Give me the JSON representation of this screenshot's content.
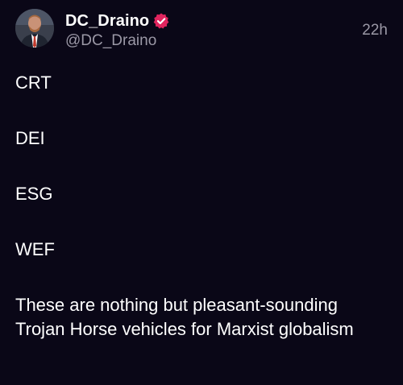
{
  "author": {
    "display_name": "DC_Draino",
    "handle": "@DC_Draino",
    "avatar_icon": "profile-photo",
    "verified_icon": "verified-badge-icon",
    "verified_color": "#e0245e"
  },
  "timestamp": "22h",
  "post": {
    "paragraphs": [
      "CRT",
      "DEI",
      "ESG",
      "WEF",
      "These are nothing but pleasant-sounding Trojan Horse vehicles for Marxist globalism"
    ]
  },
  "colors": {
    "background": "#0a0717",
    "text": "#ffffff",
    "muted": "#9b98a6"
  }
}
